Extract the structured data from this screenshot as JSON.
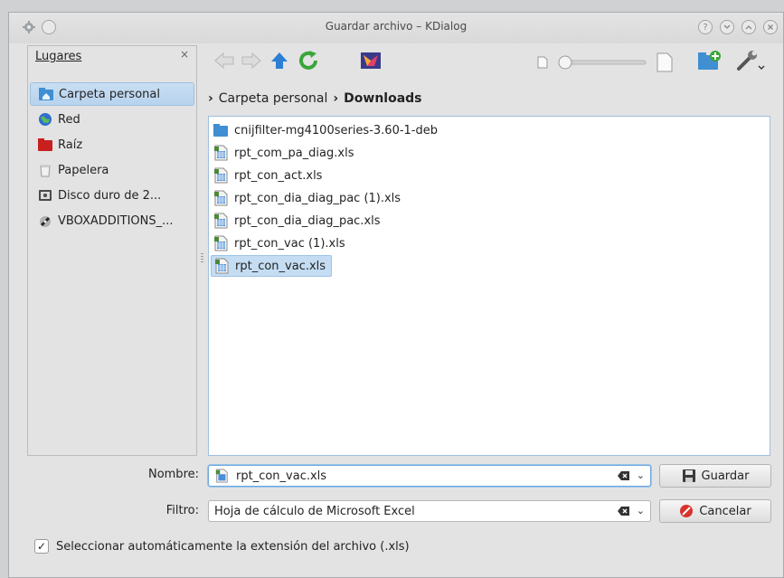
{
  "window": {
    "title": "Guardar archivo – KDialog"
  },
  "places": {
    "title": "Lugares",
    "items": [
      {
        "label": "Carpeta personal",
        "icon": "home-folder-icon",
        "selected": true
      },
      {
        "label": "Red",
        "icon": "network-globe-icon"
      },
      {
        "label": "Raíz",
        "icon": "root-folder-icon"
      },
      {
        "label": "Papelera",
        "icon": "trash-icon"
      },
      {
        "label": "Disco duro de 2...",
        "icon": "hard-disk-icon"
      },
      {
        "label": "VBOXADDITIONS_...",
        "icon": "optical-disc-icon"
      }
    ]
  },
  "breadcrumb": {
    "parent": "Carpeta personal",
    "current": "Downloads"
  },
  "files": [
    {
      "name": "cnijfilter-mg4100series-3.60-1-deb",
      "type": "folder"
    },
    {
      "name": "rpt_com_pa_diag.xls",
      "type": "spreadsheet"
    },
    {
      "name": "rpt_con_act.xls",
      "type": "spreadsheet"
    },
    {
      "name": "rpt_con_dia_diag_pac (1).xls",
      "type": "spreadsheet"
    },
    {
      "name": "rpt_con_dia_diag_pac.xls",
      "type": "spreadsheet"
    },
    {
      "name": "rpt_con_vac (1).xls",
      "type": "spreadsheet"
    },
    {
      "name": "rpt_con_vac.xls",
      "type": "spreadsheet",
      "selected": true
    }
  ],
  "form": {
    "name_label": "Nombre:",
    "name_value": "rpt_con_vac.xls",
    "filter_label": "Filtro:",
    "filter_value": "Hoja de cálculo de Microsoft Excel",
    "save_label": "Guardar",
    "cancel_label": "Cancelar",
    "auto_ext_label": "Seleccionar automáticamente la extensión del archivo (.xls)",
    "auto_ext_checked": true
  },
  "zoom": {
    "level": 0.0
  }
}
